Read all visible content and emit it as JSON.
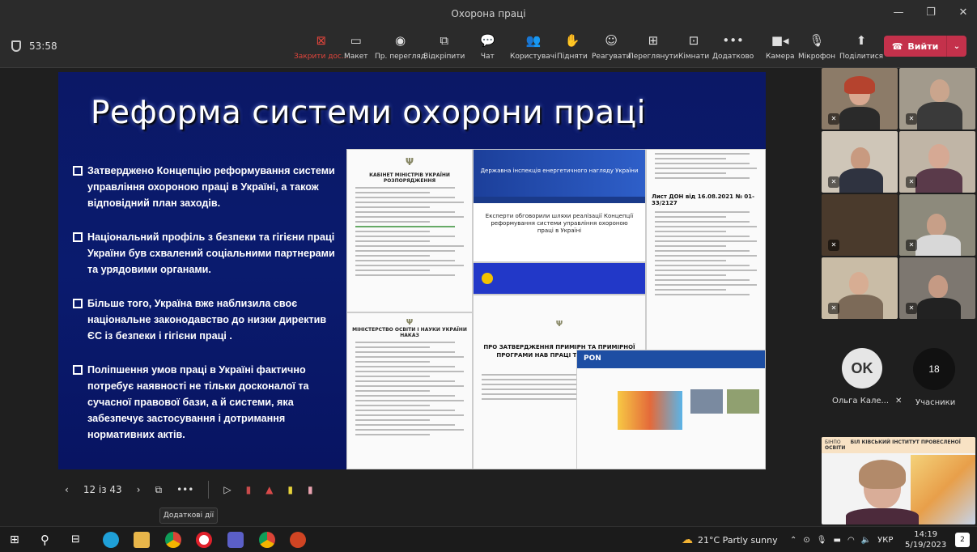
{
  "window": {
    "title": "Охорона праці"
  },
  "toolbar": {
    "timer": "53:58",
    "buttons": [
      {
        "label": "Закрити дос...",
        "icon": "close-share-icon"
      },
      {
        "label": "Макет",
        "icon": "layout-icon"
      },
      {
        "label": "Пр. перегляд",
        "icon": "preview-icon"
      },
      {
        "label": "Відкріпити",
        "icon": "popout-icon"
      },
      {
        "label": "Чат",
        "icon": "chat-icon"
      },
      {
        "label": "Користувачі",
        "icon": "people-icon"
      },
      {
        "label": "Підняти",
        "icon": "raise-hand-icon"
      },
      {
        "label": "Реагувати",
        "icon": "react-icon"
      },
      {
        "label": "Переглянути",
        "icon": "view-icon"
      },
      {
        "label": "Кімнати",
        "icon": "rooms-icon"
      },
      {
        "label": "Додатково",
        "icon": "more-icon"
      },
      {
        "label": "Камера",
        "icon": "camera-icon"
      },
      {
        "label": "Мікрофон",
        "icon": "mic-icon"
      },
      {
        "label": "Поділитися",
        "icon": "share-icon"
      }
    ],
    "leave_label": "Вийти"
  },
  "slide": {
    "title": "Реформа системи охорони праці",
    "bullets": [
      "Затверджено Концепцію реформування системи управління охороною праці в Україні, а також відповідний план заходів.",
      "Національний профіль з безпеки та гігієни праці України був схвалений соціальними партнерами та урядовими органами.",
      "Більше того, Україна вже наблизила своє національне законодавство до низки директив ЄС із безпеки і гігієни праці .",
      "Поліпшення умов праці в Україні фактично потребує наявності не тільки досконалої та сучасної правової бази, а й системи, яка забезпечує застосування і дотримання нормативних актів."
    ],
    "docs": {
      "ministry_head": "КАБІНЕТ МІНІСТРІВ УКРАЇНИ",
      "ministry_sub": "РОЗПОРЯДЖЕННЯ",
      "inspection_title": "Державна інспекція енергетичного нагляду України",
      "experts_title": "Експерти обговорили шляхи реалізації Концепції реформування системи управління охороною праці в Україні",
      "letter_title": "Лист ДОН від 16.08.2021 № 01-33/2127",
      "approval_title": "ПРО ЗАТВЕРДЖЕННЯ ПРИМІРН ТА ПРИМІРНОЇ ПРОГРАМИ НАВ ПРАЦІ ТА БЕЗПЕКИ Ж",
      "pon_label": "PON",
      "ministry_order": "МІНІСТЕРСТВО ОСВІТИ І НАУКИ УКРАЇНИ",
      "order_label": "НАКАЗ"
    }
  },
  "presenter": {
    "page_indicator": "12 із 43",
    "tooltip": "Додаткові дії"
  },
  "participants": {
    "ok_initials": "OK",
    "ok_name": "Ольга Кале...",
    "count": "18",
    "count_label": "Учасники",
    "presenter_banner": "БІНПО",
    "presenter_banner_text": "БІЛ КІВСЬКИЙ ІНСТИТУТ ПРОВЕСЛЕНОЇ ОСВІТИ"
  },
  "taskbar": {
    "weather": "21°C  Partly sunny",
    "lang": "УКР",
    "time": "14:19",
    "date": "5/19/2023",
    "notifications": "2"
  },
  "colors": {
    "leave": "#c4314b",
    "slide_bg": "#0b1866",
    "accent_red": "#e0453c"
  }
}
